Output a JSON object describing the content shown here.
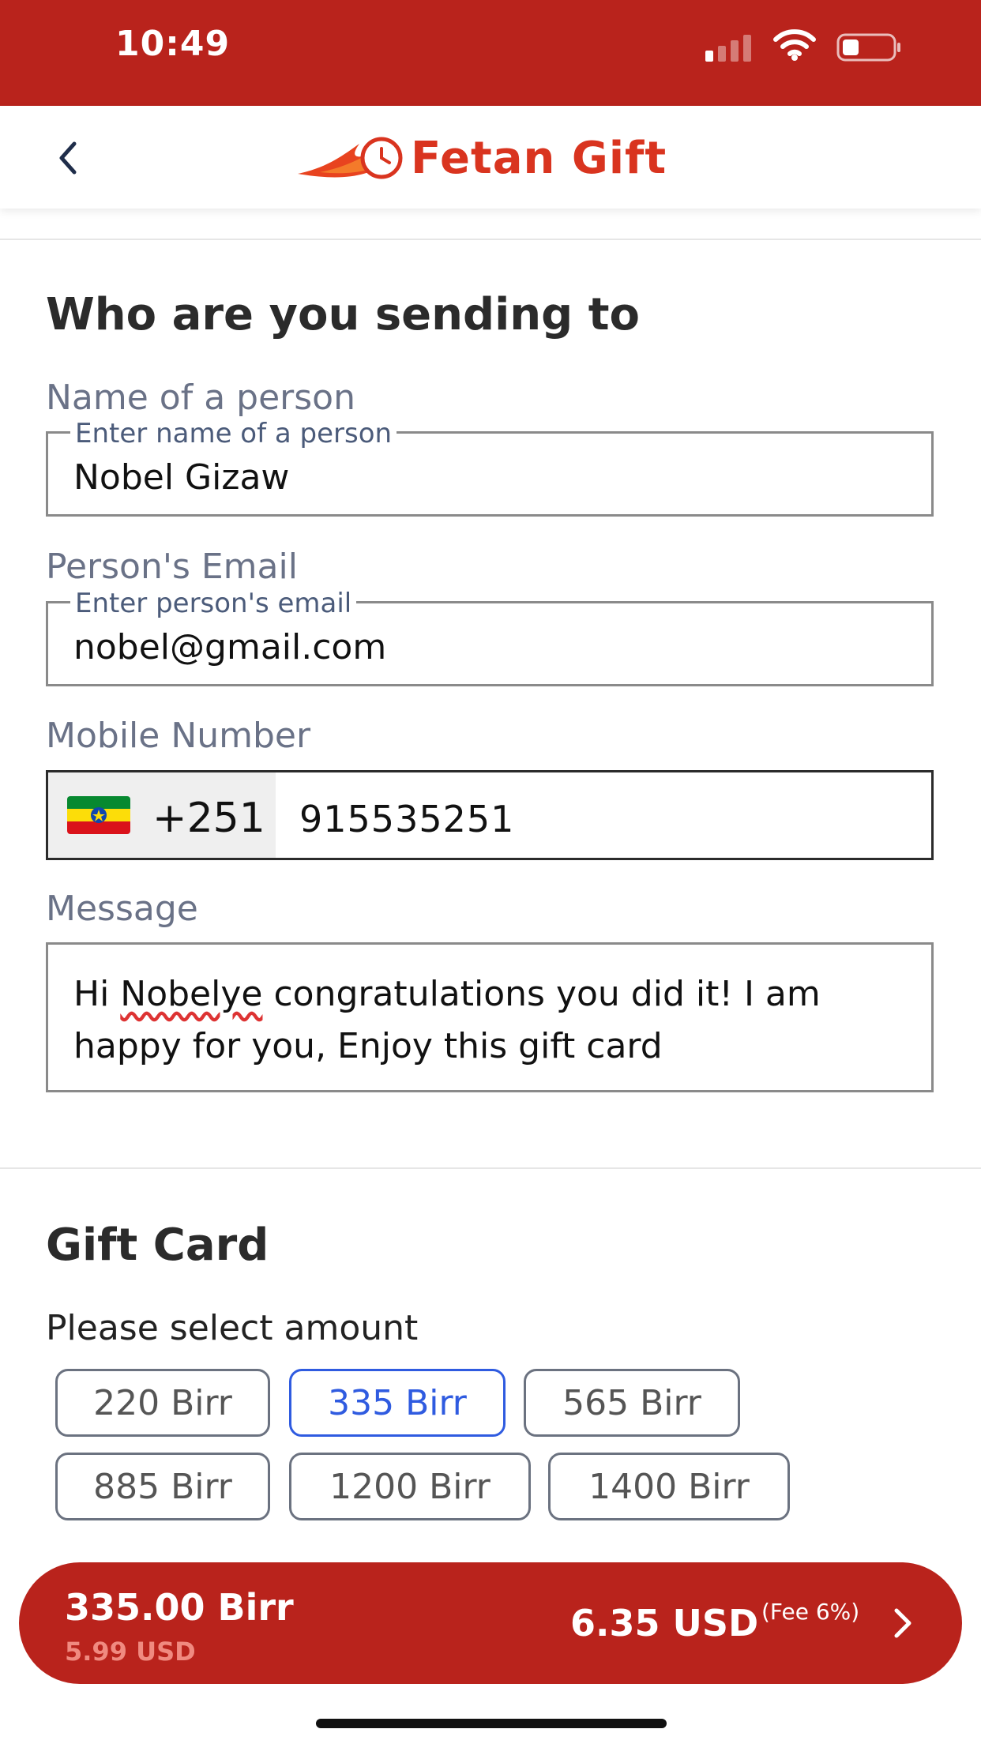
{
  "status_bar": {
    "time": "10:49"
  },
  "header": {
    "logo_text": "Fetan Gift"
  },
  "recipient": {
    "title": "Who are you sending to",
    "name_label": "Name of a person",
    "name_placeholder": "Enter name of a person",
    "name_value": "Nobel Gizaw",
    "email_label": "Person's Email",
    "email_placeholder": "Enter person's email",
    "email_value": "nobel@gmail.com",
    "mobile_label": "Mobile Number",
    "country_code": "+251",
    "phone_value": "915535251",
    "message_label": "Message",
    "message_part1": "Hi ",
    "message_misspelled": "Nobelye",
    "message_part2": " congratulations you did it! I am happy for you, Enjoy this gift card"
  },
  "gift_card": {
    "title": "Gift Card",
    "subtitle": "Please select amount",
    "amounts": [
      "220 Birr",
      "335 Birr",
      "565 Birr",
      "885 Birr",
      "1200 Birr",
      "1400 Birr"
    ],
    "selected": "335 Birr"
  },
  "footer": {
    "total_birr": "335.00 Birr",
    "base_usd": "5.99 USD",
    "total_usd": "6.35 USD",
    "fee": "(Fee 6%)"
  },
  "colors": {
    "brand_red": "#b9231c",
    "selected_blue": "#2f5be0",
    "logo_orange": "#d9341f"
  }
}
